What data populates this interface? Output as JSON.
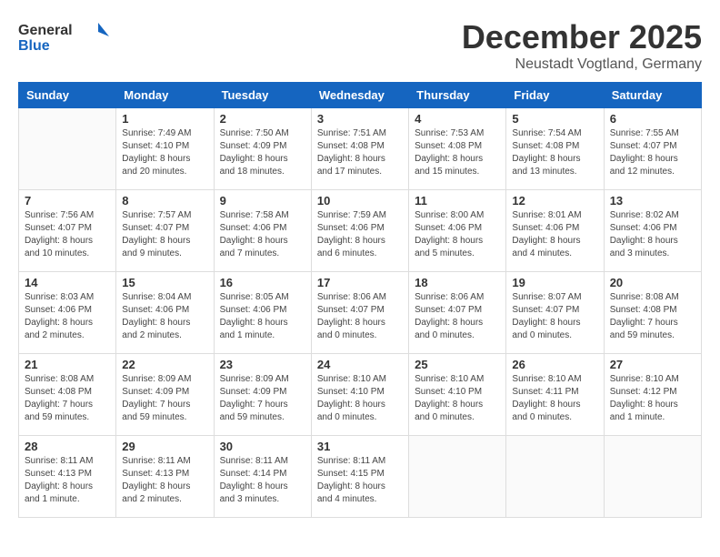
{
  "header": {
    "logo_general": "General",
    "logo_blue": "Blue",
    "month": "December 2025",
    "location": "Neustadt Vogtland, Germany"
  },
  "weekdays": [
    "Sunday",
    "Monday",
    "Tuesday",
    "Wednesday",
    "Thursday",
    "Friday",
    "Saturday"
  ],
  "weeks": [
    [
      {
        "day": "",
        "info": ""
      },
      {
        "day": "1",
        "info": "Sunrise: 7:49 AM\nSunset: 4:10 PM\nDaylight: 8 hours\nand 20 minutes."
      },
      {
        "day": "2",
        "info": "Sunrise: 7:50 AM\nSunset: 4:09 PM\nDaylight: 8 hours\nand 18 minutes."
      },
      {
        "day": "3",
        "info": "Sunrise: 7:51 AM\nSunset: 4:08 PM\nDaylight: 8 hours\nand 17 minutes."
      },
      {
        "day": "4",
        "info": "Sunrise: 7:53 AM\nSunset: 4:08 PM\nDaylight: 8 hours\nand 15 minutes."
      },
      {
        "day": "5",
        "info": "Sunrise: 7:54 AM\nSunset: 4:08 PM\nDaylight: 8 hours\nand 13 minutes."
      },
      {
        "day": "6",
        "info": "Sunrise: 7:55 AM\nSunset: 4:07 PM\nDaylight: 8 hours\nand 12 minutes."
      }
    ],
    [
      {
        "day": "7",
        "info": "Sunrise: 7:56 AM\nSunset: 4:07 PM\nDaylight: 8 hours\nand 10 minutes."
      },
      {
        "day": "8",
        "info": "Sunrise: 7:57 AM\nSunset: 4:07 PM\nDaylight: 8 hours\nand 9 minutes."
      },
      {
        "day": "9",
        "info": "Sunrise: 7:58 AM\nSunset: 4:06 PM\nDaylight: 8 hours\nand 7 minutes."
      },
      {
        "day": "10",
        "info": "Sunrise: 7:59 AM\nSunset: 4:06 PM\nDaylight: 8 hours\nand 6 minutes."
      },
      {
        "day": "11",
        "info": "Sunrise: 8:00 AM\nSunset: 4:06 PM\nDaylight: 8 hours\nand 5 minutes."
      },
      {
        "day": "12",
        "info": "Sunrise: 8:01 AM\nSunset: 4:06 PM\nDaylight: 8 hours\nand 4 minutes."
      },
      {
        "day": "13",
        "info": "Sunrise: 8:02 AM\nSunset: 4:06 PM\nDaylight: 8 hours\nand 3 minutes."
      }
    ],
    [
      {
        "day": "14",
        "info": "Sunrise: 8:03 AM\nSunset: 4:06 PM\nDaylight: 8 hours\nand 2 minutes."
      },
      {
        "day": "15",
        "info": "Sunrise: 8:04 AM\nSunset: 4:06 PM\nDaylight: 8 hours\nand 2 minutes."
      },
      {
        "day": "16",
        "info": "Sunrise: 8:05 AM\nSunset: 4:06 PM\nDaylight: 8 hours\nand 1 minute."
      },
      {
        "day": "17",
        "info": "Sunrise: 8:06 AM\nSunset: 4:07 PM\nDaylight: 8 hours\nand 0 minutes."
      },
      {
        "day": "18",
        "info": "Sunrise: 8:06 AM\nSunset: 4:07 PM\nDaylight: 8 hours\nand 0 minutes."
      },
      {
        "day": "19",
        "info": "Sunrise: 8:07 AM\nSunset: 4:07 PM\nDaylight: 8 hours\nand 0 minutes."
      },
      {
        "day": "20",
        "info": "Sunrise: 8:08 AM\nSunset: 4:08 PM\nDaylight: 7 hours\nand 59 minutes."
      }
    ],
    [
      {
        "day": "21",
        "info": "Sunrise: 8:08 AM\nSunset: 4:08 PM\nDaylight: 7 hours\nand 59 minutes."
      },
      {
        "day": "22",
        "info": "Sunrise: 8:09 AM\nSunset: 4:09 PM\nDaylight: 7 hours\nand 59 minutes."
      },
      {
        "day": "23",
        "info": "Sunrise: 8:09 AM\nSunset: 4:09 PM\nDaylight: 7 hours\nand 59 minutes."
      },
      {
        "day": "24",
        "info": "Sunrise: 8:10 AM\nSunset: 4:10 PM\nDaylight: 8 hours\nand 0 minutes."
      },
      {
        "day": "25",
        "info": "Sunrise: 8:10 AM\nSunset: 4:10 PM\nDaylight: 8 hours\nand 0 minutes."
      },
      {
        "day": "26",
        "info": "Sunrise: 8:10 AM\nSunset: 4:11 PM\nDaylight: 8 hours\nand 0 minutes."
      },
      {
        "day": "27",
        "info": "Sunrise: 8:10 AM\nSunset: 4:12 PM\nDaylight: 8 hours\nand 1 minute."
      }
    ],
    [
      {
        "day": "28",
        "info": "Sunrise: 8:11 AM\nSunset: 4:13 PM\nDaylight: 8 hours\nand 1 minute."
      },
      {
        "day": "29",
        "info": "Sunrise: 8:11 AM\nSunset: 4:13 PM\nDaylight: 8 hours\nand 2 minutes."
      },
      {
        "day": "30",
        "info": "Sunrise: 8:11 AM\nSunset: 4:14 PM\nDaylight: 8 hours\nand 3 minutes."
      },
      {
        "day": "31",
        "info": "Sunrise: 8:11 AM\nSunset: 4:15 PM\nDaylight: 8 hours\nand 4 minutes."
      },
      {
        "day": "",
        "info": ""
      },
      {
        "day": "",
        "info": ""
      },
      {
        "day": "",
        "info": ""
      }
    ]
  ]
}
